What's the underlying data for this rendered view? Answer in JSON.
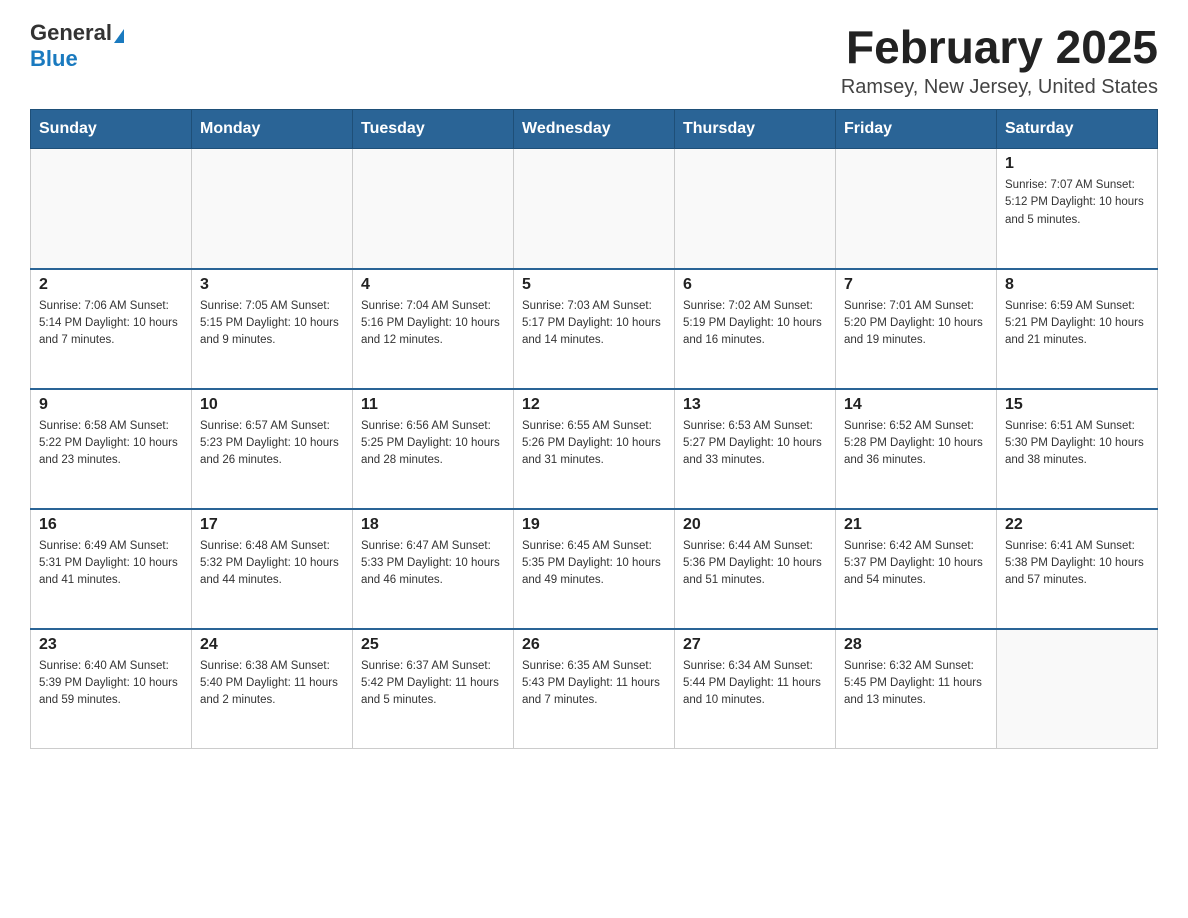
{
  "header": {
    "logo_general": "General",
    "logo_blue": "Blue",
    "month_title": "February 2025",
    "location": "Ramsey, New Jersey, United States"
  },
  "days_of_week": [
    "Sunday",
    "Monday",
    "Tuesday",
    "Wednesday",
    "Thursday",
    "Friday",
    "Saturday"
  ],
  "weeks": [
    [
      {
        "day": "",
        "info": ""
      },
      {
        "day": "",
        "info": ""
      },
      {
        "day": "",
        "info": ""
      },
      {
        "day": "",
        "info": ""
      },
      {
        "day": "",
        "info": ""
      },
      {
        "day": "",
        "info": ""
      },
      {
        "day": "1",
        "info": "Sunrise: 7:07 AM\nSunset: 5:12 PM\nDaylight: 10 hours and 5 minutes."
      }
    ],
    [
      {
        "day": "2",
        "info": "Sunrise: 7:06 AM\nSunset: 5:14 PM\nDaylight: 10 hours and 7 minutes."
      },
      {
        "day": "3",
        "info": "Sunrise: 7:05 AM\nSunset: 5:15 PM\nDaylight: 10 hours and 9 minutes."
      },
      {
        "day": "4",
        "info": "Sunrise: 7:04 AM\nSunset: 5:16 PM\nDaylight: 10 hours and 12 minutes."
      },
      {
        "day": "5",
        "info": "Sunrise: 7:03 AM\nSunset: 5:17 PM\nDaylight: 10 hours and 14 minutes."
      },
      {
        "day": "6",
        "info": "Sunrise: 7:02 AM\nSunset: 5:19 PM\nDaylight: 10 hours and 16 minutes."
      },
      {
        "day": "7",
        "info": "Sunrise: 7:01 AM\nSunset: 5:20 PM\nDaylight: 10 hours and 19 minutes."
      },
      {
        "day": "8",
        "info": "Sunrise: 6:59 AM\nSunset: 5:21 PM\nDaylight: 10 hours and 21 minutes."
      }
    ],
    [
      {
        "day": "9",
        "info": "Sunrise: 6:58 AM\nSunset: 5:22 PM\nDaylight: 10 hours and 23 minutes."
      },
      {
        "day": "10",
        "info": "Sunrise: 6:57 AM\nSunset: 5:23 PM\nDaylight: 10 hours and 26 minutes."
      },
      {
        "day": "11",
        "info": "Sunrise: 6:56 AM\nSunset: 5:25 PM\nDaylight: 10 hours and 28 minutes."
      },
      {
        "day": "12",
        "info": "Sunrise: 6:55 AM\nSunset: 5:26 PM\nDaylight: 10 hours and 31 minutes."
      },
      {
        "day": "13",
        "info": "Sunrise: 6:53 AM\nSunset: 5:27 PM\nDaylight: 10 hours and 33 minutes."
      },
      {
        "day": "14",
        "info": "Sunrise: 6:52 AM\nSunset: 5:28 PM\nDaylight: 10 hours and 36 minutes."
      },
      {
        "day": "15",
        "info": "Sunrise: 6:51 AM\nSunset: 5:30 PM\nDaylight: 10 hours and 38 minutes."
      }
    ],
    [
      {
        "day": "16",
        "info": "Sunrise: 6:49 AM\nSunset: 5:31 PM\nDaylight: 10 hours and 41 minutes."
      },
      {
        "day": "17",
        "info": "Sunrise: 6:48 AM\nSunset: 5:32 PM\nDaylight: 10 hours and 44 minutes."
      },
      {
        "day": "18",
        "info": "Sunrise: 6:47 AM\nSunset: 5:33 PM\nDaylight: 10 hours and 46 minutes."
      },
      {
        "day": "19",
        "info": "Sunrise: 6:45 AM\nSunset: 5:35 PM\nDaylight: 10 hours and 49 minutes."
      },
      {
        "day": "20",
        "info": "Sunrise: 6:44 AM\nSunset: 5:36 PM\nDaylight: 10 hours and 51 minutes."
      },
      {
        "day": "21",
        "info": "Sunrise: 6:42 AM\nSunset: 5:37 PM\nDaylight: 10 hours and 54 minutes."
      },
      {
        "day": "22",
        "info": "Sunrise: 6:41 AM\nSunset: 5:38 PM\nDaylight: 10 hours and 57 minutes."
      }
    ],
    [
      {
        "day": "23",
        "info": "Sunrise: 6:40 AM\nSunset: 5:39 PM\nDaylight: 10 hours and 59 minutes."
      },
      {
        "day": "24",
        "info": "Sunrise: 6:38 AM\nSunset: 5:40 PM\nDaylight: 11 hours and 2 minutes."
      },
      {
        "day": "25",
        "info": "Sunrise: 6:37 AM\nSunset: 5:42 PM\nDaylight: 11 hours and 5 minutes."
      },
      {
        "day": "26",
        "info": "Sunrise: 6:35 AM\nSunset: 5:43 PM\nDaylight: 11 hours and 7 minutes."
      },
      {
        "day": "27",
        "info": "Sunrise: 6:34 AM\nSunset: 5:44 PM\nDaylight: 11 hours and 10 minutes."
      },
      {
        "day": "28",
        "info": "Sunrise: 6:32 AM\nSunset: 5:45 PM\nDaylight: 11 hours and 13 minutes."
      },
      {
        "day": "",
        "info": ""
      }
    ]
  ]
}
